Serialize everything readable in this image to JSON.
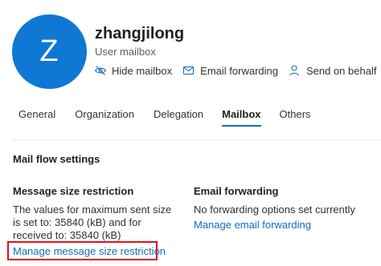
{
  "user": {
    "initial": "Z",
    "name": "zhangjilong",
    "type": "User mailbox"
  },
  "actions": [
    {
      "label": "Hide mailbox",
      "icon": "hide-mailbox-icon"
    },
    {
      "label": "Email forwarding",
      "icon": "mail-forward-icon"
    },
    {
      "label": "Send on behalf",
      "icon": "person-icon"
    }
  ],
  "tabs": [
    "General",
    "Organization",
    "Delegation",
    "Mailbox",
    "Others"
  ],
  "active_tab": "Mailbox",
  "mail_flow": {
    "title": "Mail flow settings",
    "size_restriction": {
      "title": "Message size restriction",
      "text": "The values for maximum sent size is set to: 35840 (kB) and for received to: 35840 (kB)",
      "link": "Manage message size restriction"
    },
    "email_forwarding": {
      "title": "Email forwarding",
      "text": "No forwarding options set currently",
      "link": "Manage email forwarding"
    }
  },
  "colors": {
    "avatar": "#0f78d4",
    "accent": "#0f6cbd",
    "highlight": "#e3111b"
  }
}
